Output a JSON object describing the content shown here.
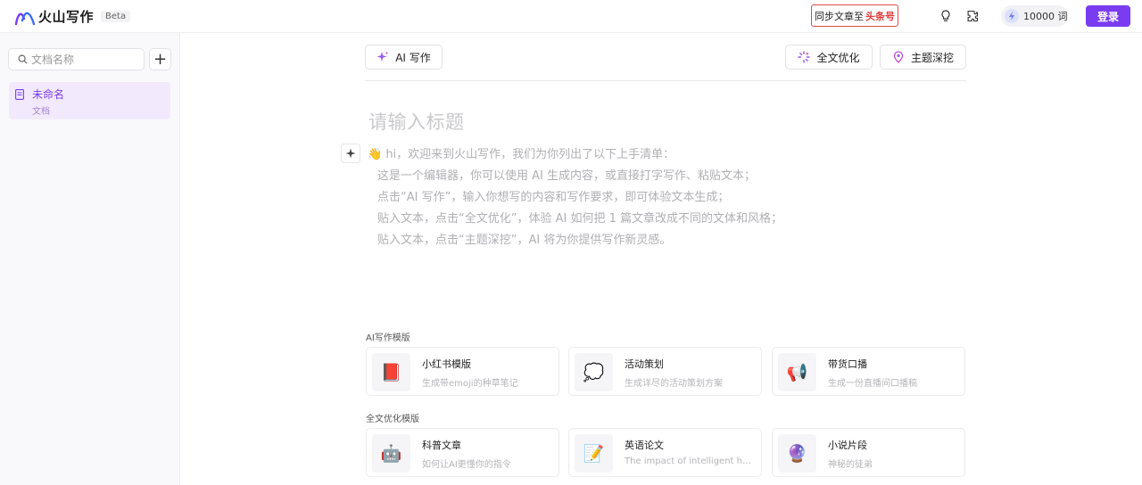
{
  "header": {
    "logo_text": "火山写作",
    "beta": "Beta",
    "sync_label": "同步文章至",
    "sync_brand": "头条号",
    "credits": "10000 词",
    "login": "登录"
  },
  "sidebar": {
    "search_placeholder": "文档名称",
    "add": "+",
    "docs": [
      {
        "title": "未命名",
        "subtitle": "文档"
      }
    ]
  },
  "toolbar": {
    "ai_write": "AI 写作",
    "full_optimize": "全文优化",
    "topic_dig": "主题深挖"
  },
  "editor": {
    "title_placeholder": "请输入标题",
    "guide": [
      "👋 hi，欢迎来到火山写作，我们为你列出了以下上手清单：",
      "这是一个编辑器，你可以使用 AI 生成内容，或直接打字写作、粘贴文本；",
      "点击“AI 写作”，输入你想写的内容和写作要求，即可体验文本生成；",
      "贴入文本，点击“全文优化”，体验 AI 如何把 1 篇文章改成不同的文体和风格；",
      "贴入文本，点击“主题深挖”，AI 将为你提供写作新灵感。"
    ]
  },
  "templates": {
    "ai_label": "AI写作模版",
    "ai_cards": [
      {
        "icon": "📕",
        "title": "小红书模版",
        "desc": "生成带emoji的种草笔记"
      },
      {
        "icon": "💭",
        "title": "活动策划",
        "desc": "生成详尽的活动策划方案"
      },
      {
        "icon": "📢",
        "title": "带货口播",
        "desc": "生成一份直播间口播稿"
      }
    ],
    "opt_label": "全文优化模版",
    "opt_cards": [
      {
        "icon": "🤖",
        "title": "科普文章",
        "desc": "如何让AI更懂你的指令"
      },
      {
        "icon": "📝",
        "title": "英语论文",
        "desc": "The impact of intelligent household"
      },
      {
        "icon": "🔮",
        "title": "小说片段",
        "desc": "神秘的徒弟"
      }
    ]
  },
  "colors": {
    "accent": "#7a3cf0",
    "brand_red": "#e23c3c"
  }
}
